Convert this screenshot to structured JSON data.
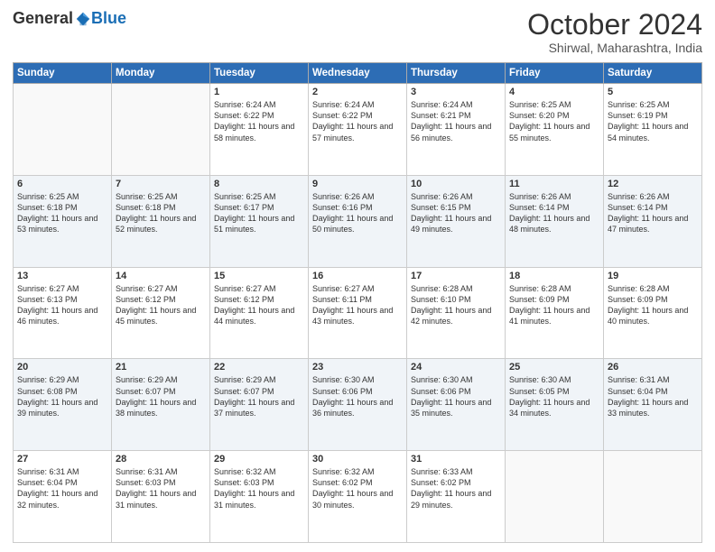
{
  "header": {
    "logo_general": "General",
    "logo_blue": "Blue",
    "title": "October 2024",
    "location": "Shirwal, Maharashtra, India"
  },
  "calendar": {
    "days_of_week": [
      "Sunday",
      "Monday",
      "Tuesday",
      "Wednesday",
      "Thursday",
      "Friday",
      "Saturday"
    ],
    "weeks": [
      [
        {
          "day": "",
          "info": ""
        },
        {
          "day": "",
          "info": ""
        },
        {
          "day": "1",
          "info": "Sunrise: 6:24 AM\nSunset: 6:22 PM\nDaylight: 11 hours and 58 minutes."
        },
        {
          "day": "2",
          "info": "Sunrise: 6:24 AM\nSunset: 6:22 PM\nDaylight: 11 hours and 57 minutes."
        },
        {
          "day": "3",
          "info": "Sunrise: 6:24 AM\nSunset: 6:21 PM\nDaylight: 11 hours and 56 minutes."
        },
        {
          "day": "4",
          "info": "Sunrise: 6:25 AM\nSunset: 6:20 PM\nDaylight: 11 hours and 55 minutes."
        },
        {
          "day": "5",
          "info": "Sunrise: 6:25 AM\nSunset: 6:19 PM\nDaylight: 11 hours and 54 minutes."
        }
      ],
      [
        {
          "day": "6",
          "info": "Sunrise: 6:25 AM\nSunset: 6:18 PM\nDaylight: 11 hours and 53 minutes."
        },
        {
          "day": "7",
          "info": "Sunrise: 6:25 AM\nSunset: 6:18 PM\nDaylight: 11 hours and 52 minutes."
        },
        {
          "day": "8",
          "info": "Sunrise: 6:25 AM\nSunset: 6:17 PM\nDaylight: 11 hours and 51 minutes."
        },
        {
          "day": "9",
          "info": "Sunrise: 6:26 AM\nSunset: 6:16 PM\nDaylight: 11 hours and 50 minutes."
        },
        {
          "day": "10",
          "info": "Sunrise: 6:26 AM\nSunset: 6:15 PM\nDaylight: 11 hours and 49 minutes."
        },
        {
          "day": "11",
          "info": "Sunrise: 6:26 AM\nSunset: 6:14 PM\nDaylight: 11 hours and 48 minutes."
        },
        {
          "day": "12",
          "info": "Sunrise: 6:26 AM\nSunset: 6:14 PM\nDaylight: 11 hours and 47 minutes."
        }
      ],
      [
        {
          "day": "13",
          "info": "Sunrise: 6:27 AM\nSunset: 6:13 PM\nDaylight: 11 hours and 46 minutes."
        },
        {
          "day": "14",
          "info": "Sunrise: 6:27 AM\nSunset: 6:12 PM\nDaylight: 11 hours and 45 minutes."
        },
        {
          "day": "15",
          "info": "Sunrise: 6:27 AM\nSunset: 6:12 PM\nDaylight: 11 hours and 44 minutes."
        },
        {
          "day": "16",
          "info": "Sunrise: 6:27 AM\nSunset: 6:11 PM\nDaylight: 11 hours and 43 minutes."
        },
        {
          "day": "17",
          "info": "Sunrise: 6:28 AM\nSunset: 6:10 PM\nDaylight: 11 hours and 42 minutes."
        },
        {
          "day": "18",
          "info": "Sunrise: 6:28 AM\nSunset: 6:09 PM\nDaylight: 11 hours and 41 minutes."
        },
        {
          "day": "19",
          "info": "Sunrise: 6:28 AM\nSunset: 6:09 PM\nDaylight: 11 hours and 40 minutes."
        }
      ],
      [
        {
          "day": "20",
          "info": "Sunrise: 6:29 AM\nSunset: 6:08 PM\nDaylight: 11 hours and 39 minutes."
        },
        {
          "day": "21",
          "info": "Sunrise: 6:29 AM\nSunset: 6:07 PM\nDaylight: 11 hours and 38 minutes."
        },
        {
          "day": "22",
          "info": "Sunrise: 6:29 AM\nSunset: 6:07 PM\nDaylight: 11 hours and 37 minutes."
        },
        {
          "day": "23",
          "info": "Sunrise: 6:30 AM\nSunset: 6:06 PM\nDaylight: 11 hours and 36 minutes."
        },
        {
          "day": "24",
          "info": "Sunrise: 6:30 AM\nSunset: 6:06 PM\nDaylight: 11 hours and 35 minutes."
        },
        {
          "day": "25",
          "info": "Sunrise: 6:30 AM\nSunset: 6:05 PM\nDaylight: 11 hours and 34 minutes."
        },
        {
          "day": "26",
          "info": "Sunrise: 6:31 AM\nSunset: 6:04 PM\nDaylight: 11 hours and 33 minutes."
        }
      ],
      [
        {
          "day": "27",
          "info": "Sunrise: 6:31 AM\nSunset: 6:04 PM\nDaylight: 11 hours and 32 minutes."
        },
        {
          "day": "28",
          "info": "Sunrise: 6:31 AM\nSunset: 6:03 PM\nDaylight: 11 hours and 31 minutes."
        },
        {
          "day": "29",
          "info": "Sunrise: 6:32 AM\nSunset: 6:03 PM\nDaylight: 11 hours and 31 minutes."
        },
        {
          "day": "30",
          "info": "Sunrise: 6:32 AM\nSunset: 6:02 PM\nDaylight: 11 hours and 30 minutes."
        },
        {
          "day": "31",
          "info": "Sunrise: 6:33 AM\nSunset: 6:02 PM\nDaylight: 11 hours and 29 minutes."
        },
        {
          "day": "",
          "info": ""
        },
        {
          "day": "",
          "info": ""
        }
      ]
    ]
  }
}
